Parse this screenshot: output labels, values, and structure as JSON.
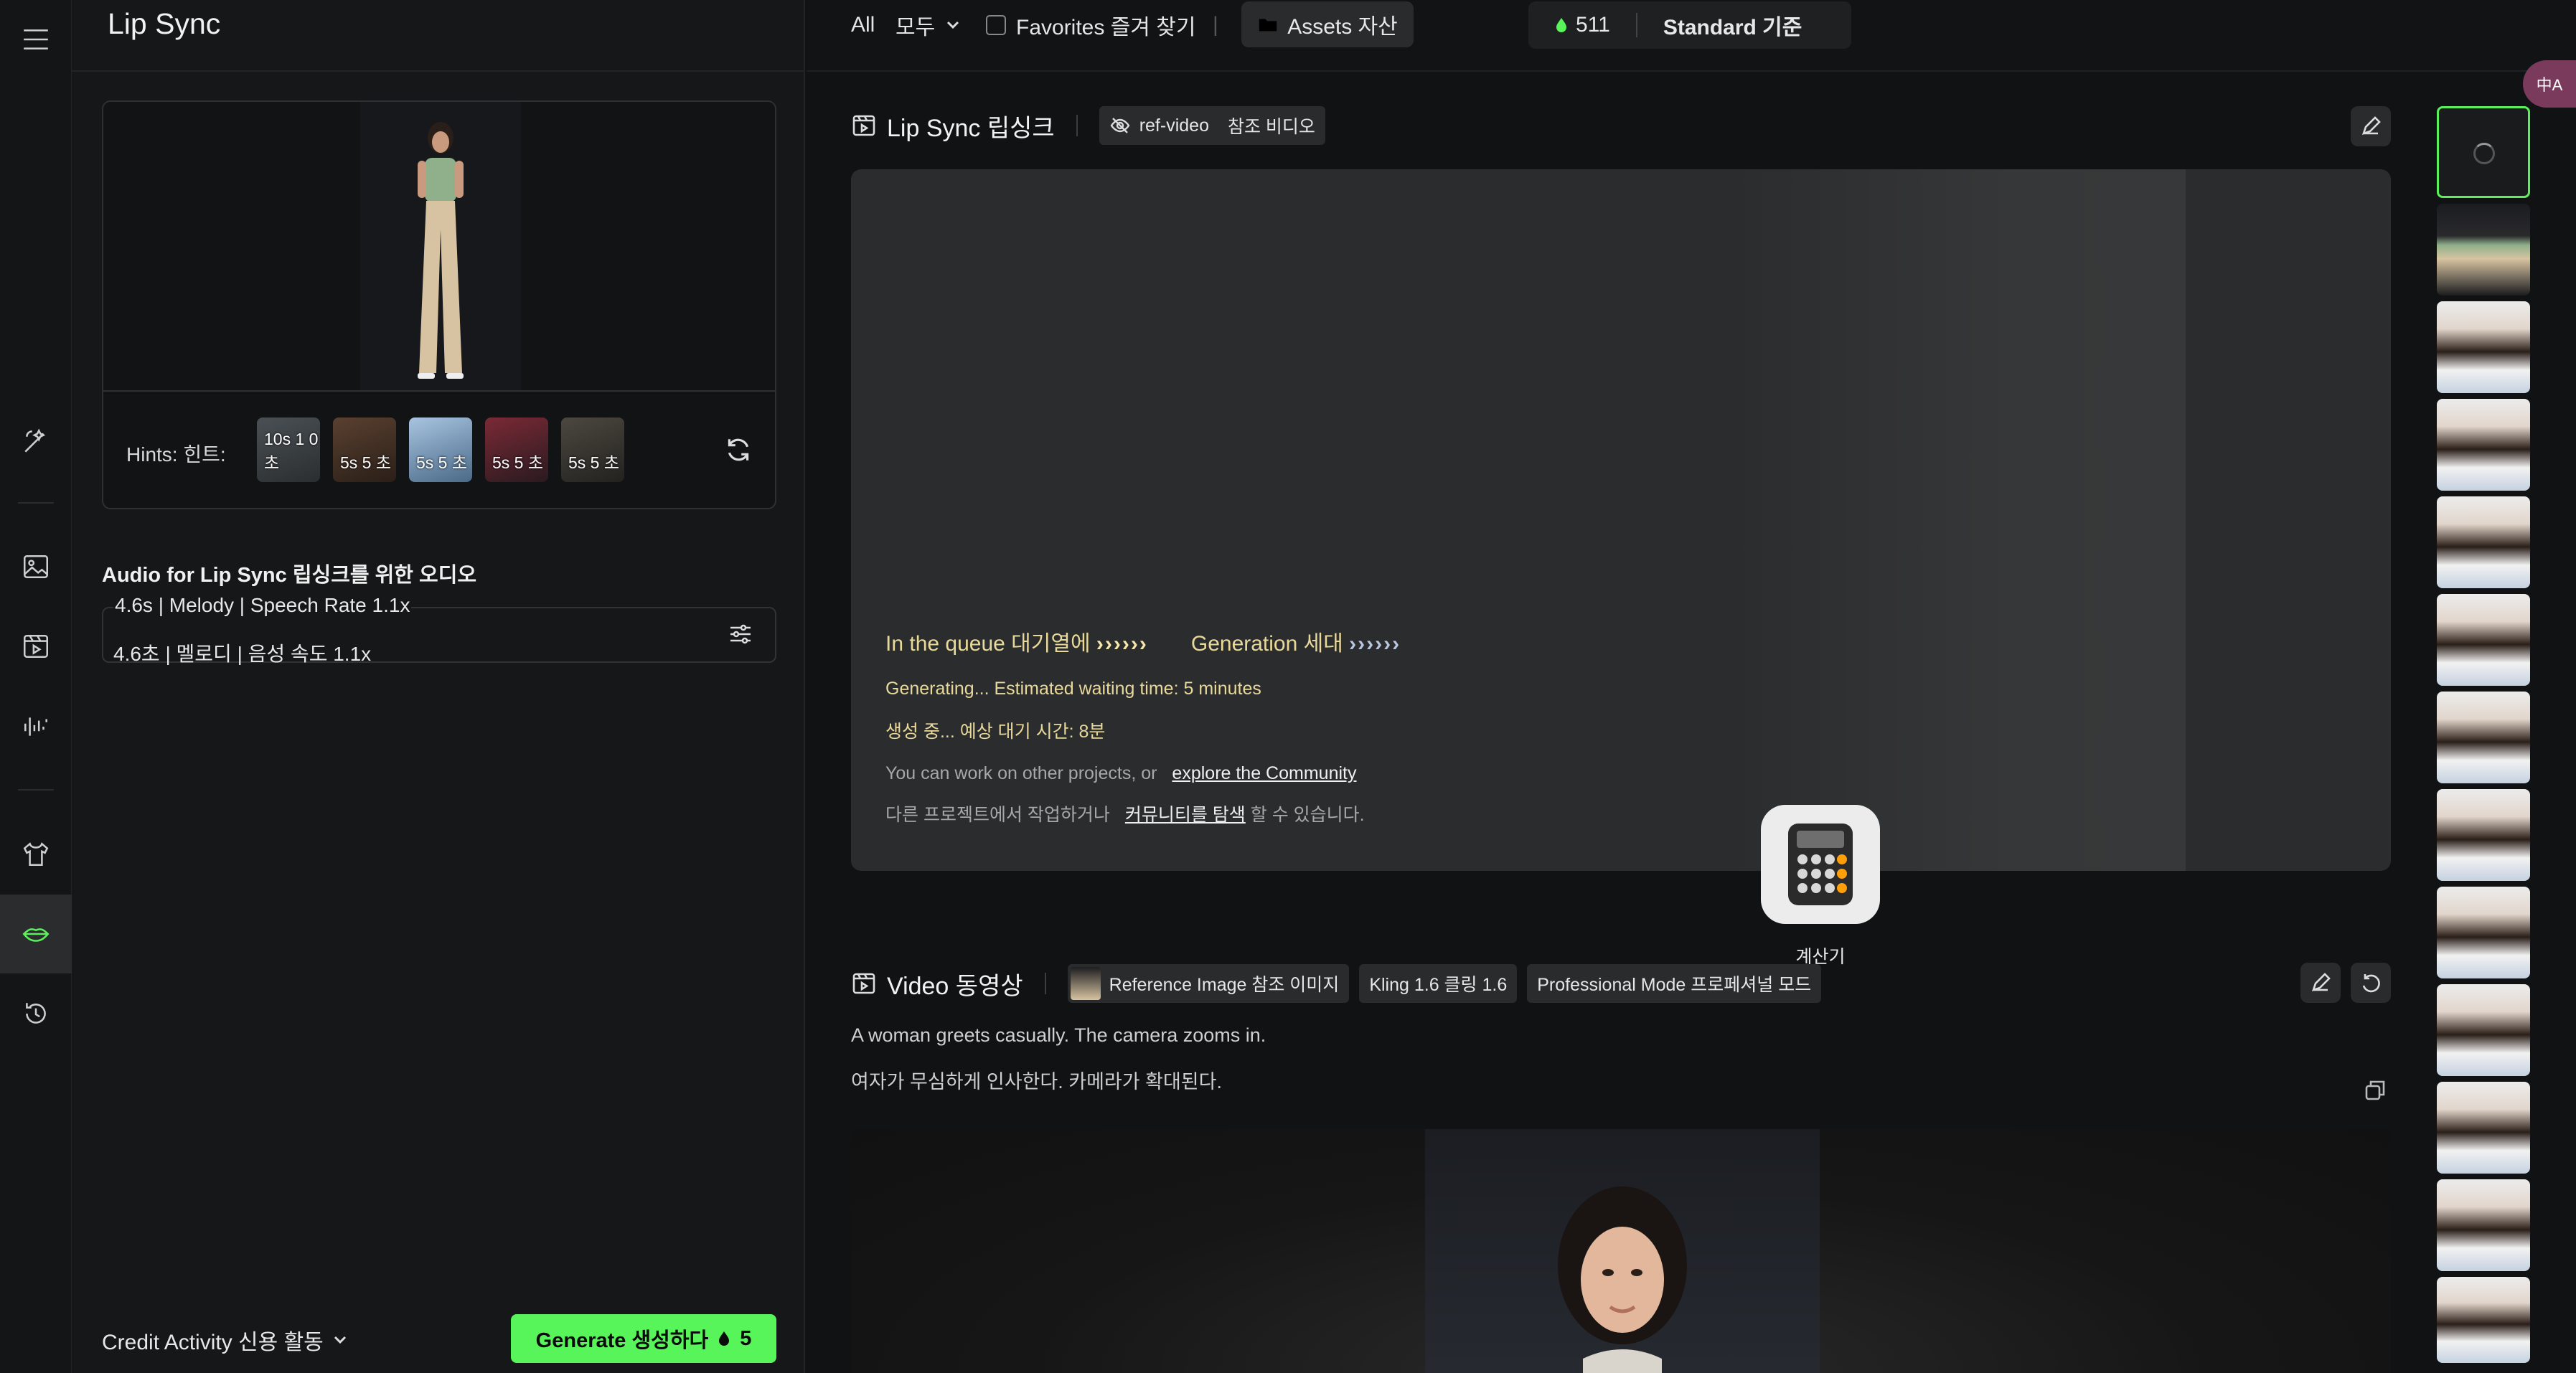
{
  "app": {
    "title": "Lip Sync"
  },
  "nav": {
    "items": [
      {
        "icon": "magic-wand-icon"
      },
      {
        "icon": "image-icon"
      },
      {
        "icon": "video-icon"
      },
      {
        "icon": "audio-wave-icon"
      },
      {
        "icon": "shirt-icon"
      },
      {
        "icon": "lips-icon",
        "active": true
      },
      {
        "icon": "history-icon"
      }
    ]
  },
  "hints": {
    "label": "Hints:  힌트:",
    "items": [
      {
        "duration": "10s  1 0초"
      },
      {
        "duration": "5s  5 초"
      },
      {
        "duration": "5s  5 초"
      },
      {
        "duration": "5s  5 초"
      },
      {
        "duration": "5s  5 초"
      }
    ]
  },
  "audio": {
    "title": "Audio for Lip Sync  립싱크를 위한 오디오",
    "line_en": "4.6s | Melody | Speech Rate 1.1x",
    "line_ko": "4.6초 | 멜로디 | 음성 속도 1.1x"
  },
  "footer": {
    "credit_activity": "Credit Activity  신용 활동",
    "generate_label": "Generate  생성하다",
    "generate_cost": "5"
  },
  "topbar": {
    "all": "All",
    "all_ko": "모두",
    "favorites": "Favorites  즐겨 찾기",
    "assets": "Assets  자산",
    "credits": "511",
    "plan": "Standard  기준"
  },
  "lipsync_section": {
    "title": "Lip Sync  립싱크",
    "tag": "ref-video",
    "tag_ko": "참조 비디오",
    "queue_label": "In the queue  대기열에",
    "queue_arrows": "››››››",
    "generation_label": "Generation  세대",
    "generation_arrows": "››››››",
    "generating_en": "Generating... Estimated waiting time: 5 minutes",
    "generating_ko": "생성 중... 예상 대기 시간: 8분",
    "community_en_prefix": "You can work on other projects, or",
    "community_en_link": "explore the Community",
    "community_ko_prefix": "다른 프로젝트에서 작업하거나",
    "community_ko_link": "커뮤니티를 탐색",
    "community_ko_suffix": "할 수 있습니다."
  },
  "overlay": {
    "calculator_label": "계산기"
  },
  "video_section": {
    "title": "Video  동영상",
    "tags": [
      "Reference Image  참조 이미지",
      "Kling 1.6  클링 1.6",
      "Professional Mode  프로페셔널 모드"
    ],
    "desc_en": "A woman greets casually. The camera zooms in.",
    "desc_ko": "여자가 무심하게 인사한다. 카메라가 확대된다."
  },
  "colors": {
    "accent": "#57f55a",
    "queue_text": "#e8d99a",
    "panel": "#2b2c2d"
  },
  "translate_fab": "中A"
}
